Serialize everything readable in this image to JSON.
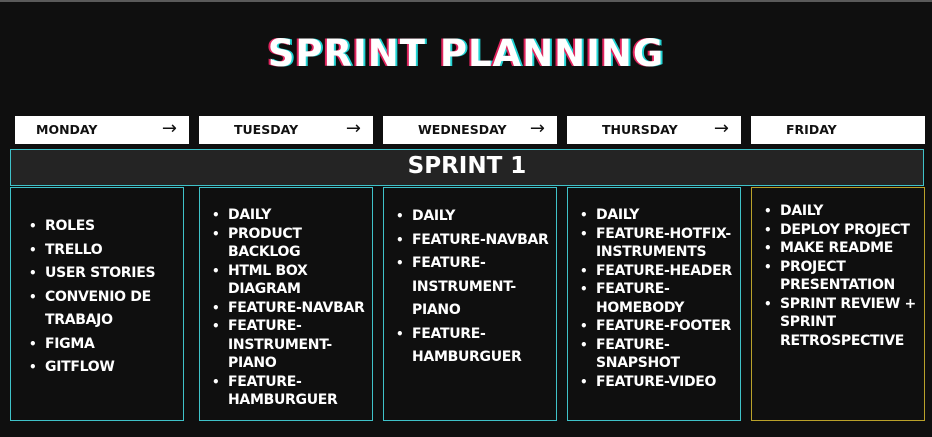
{
  "title": "SPRINT PLANNING",
  "days": [
    {
      "label": "MONDAY",
      "arrow": "→"
    },
    {
      "label": "TUESDAY",
      "arrow": "→"
    },
    {
      "label": "WEDNESDAY",
      "arrow": "→"
    },
    {
      "label": "THURSDAY",
      "arrow": "→"
    },
    {
      "label": "FRIDAY",
      "arrow": ""
    }
  ],
  "sprint_label": "SPRINT 1",
  "columns": [
    {
      "items": [
        "ROLES",
        "TRELLO",
        "USER STORIES",
        "CONVENIO DE TRABAJO",
        "FIGMA",
        "GITFLOW"
      ]
    },
    {
      "items": [
        "DAILY",
        "PRODUCT BACKLOG",
        "HTML BOX DIAGRAM",
        "FEATURE-NAVBAR",
        "FEATURE-INSTRUMENT-PIANO",
        "FEATURE-HAMBURGUER"
      ]
    },
    {
      "items": [
        "DAILY",
        "FEATURE-NAVBAR",
        "FEATURE-INSTRUMENT-PIANO",
        "FEATURE-HAMBURGUER"
      ]
    },
    {
      "items": [
        "DAILY",
        "FEATURE-HOTFIX-INSTRUMENTS",
        "FEATURE-HEADER",
        "FEATURE-HOMEBODY",
        "FEATURE-FOOTER",
        "FEATURE-SNAPSHOT",
        "FEATURE-VIDEO"
      ]
    },
    {
      "items": [
        "DAILY",
        "DEPLOY PROJECT",
        "MAKE README",
        "PROJECT PRESENTATION",
        "SPRINT REVIEW + SPRINT RETROSPECTIVE"
      ]
    }
  ]
}
